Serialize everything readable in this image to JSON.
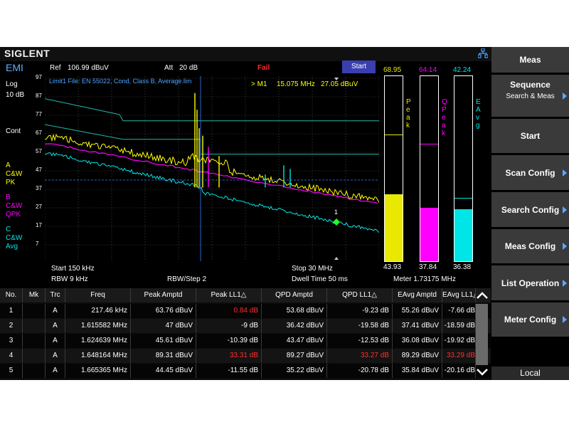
{
  "brand": "SIGLENT",
  "mode": "EMI",
  "scale": {
    "type": "Log",
    "per_div": "10 dB"
  },
  "trigger": "Cont",
  "traces": [
    {
      "letter": "A",
      "l1": "C&W",
      "l2": "PK",
      "color": "#ffff00"
    },
    {
      "letter": "B",
      "l1": "C&W",
      "l2": "QPK",
      "color": "#ff00ff"
    },
    {
      "letter": "C",
      "l1": "C&W",
      "l2": "Avg",
      "color": "#00e5e5"
    }
  ],
  "ref": {
    "label": "Ref",
    "value": "106.99 dBuV"
  },
  "att": {
    "label": "Att",
    "value": "20 dB"
  },
  "status": "Fail",
  "start_button": "Start",
  "limit_file": "Limit1 File: EN 55022, Cond, Class B, Average.lim",
  "marker": {
    "label": "> M1",
    "freq": "15.075 MHz",
    "level": "27.05 dBuV",
    "number": "1"
  },
  "y_ticks": [
    "97",
    "87",
    "77",
    "67",
    "57",
    "47",
    "37",
    "27",
    "17",
    "7"
  ],
  "settings": {
    "start": "Start  150 kHz",
    "stop": "Stop  30 MHz",
    "rbw": "RBW  9 kHz",
    "rbw_step": "RBW/Step   2",
    "dwell": "Dwell Time   50 ms",
    "meter": "Meter  1.73175 MHz"
  },
  "meters": [
    {
      "name": "Peak",
      "top": "68.95",
      "bottom": "43.93",
      "fill": 0.36,
      "limit": 0.68,
      "color": "#e8e800"
    },
    {
      "name": "QPeak",
      "top": "64.14",
      "bottom": "37.84",
      "fill": 0.29,
      "limit": 0.63,
      "color": "#ff00ff"
    },
    {
      "name": "EAvg",
      "top": "42.24",
      "bottom": "36.38",
      "fill": 0.28,
      "limit": 0.34,
      "color": "#00e5e5"
    }
  ],
  "table": {
    "headers": [
      "No.",
      "Mk",
      "Trc",
      "Freq",
      "Peak Amptd",
      "Peak LL1△",
      "QPD Amptd",
      "QPD LL1△",
      "EAvg Amptd",
      "EAvg LL1△"
    ],
    "rows": [
      {
        "no": "1",
        "mk": "",
        "trc": "A",
        "freq": "217.46 kHz",
        "peak": "63.76 dBuV",
        "peak_ll": "0.84 dB",
        "peak_fail": true,
        "qpd": "53.68 dBuV",
        "qpd_ll": "-9.23 dB",
        "qpd_fail": false,
        "eavg": "55.26 dBuV",
        "eavg_ll": "-7.66 dB",
        "eavg_fail": false
      },
      {
        "no": "2",
        "mk": "",
        "trc": "A",
        "freq": "1.615582 MHz",
        "peak": "47 dBuV",
        "peak_ll": "-9 dB",
        "peak_fail": false,
        "qpd": "36.42 dBuV",
        "qpd_ll": "-19.58 dB",
        "qpd_fail": false,
        "eavg": "37.41 dBuV",
        "eavg_ll": "-18.59 dB",
        "eavg_fail": false
      },
      {
        "no": "3",
        "mk": "",
        "trc": "A",
        "freq": "1.624639 MHz",
        "peak": "45.61 dBuV",
        "peak_ll": "-10.39 dB",
        "peak_fail": false,
        "qpd": "43.47 dBuV",
        "qpd_ll": "-12.53 dB",
        "qpd_fail": false,
        "eavg": "36.08 dBuV",
        "eavg_ll": "-19.92 dB",
        "eavg_fail": false
      },
      {
        "no": "4",
        "mk": "",
        "trc": "A",
        "freq": "1.648164 MHz",
        "peak": "89.31 dBuV",
        "peak_ll": "33.31 dB",
        "peak_fail": true,
        "qpd": "89.27 dBuV",
        "qpd_ll": "33.27 dB",
        "qpd_fail": true,
        "eavg": "89.29 dBuV",
        "eavg_ll": "33.29 dB",
        "eavg_fail": true
      },
      {
        "no": "5",
        "mk": "",
        "trc": "A",
        "freq": "1.665365 MHz",
        "peak": "44.45 dBuV",
        "peak_ll": "-11.55 dB",
        "peak_fail": false,
        "qpd": "35.22 dBuV",
        "qpd_ll": "-20.78 dB",
        "qpd_fail": false,
        "eavg": "35.84 dBuV",
        "eavg_ll": "-20.16 dB",
        "eavg_fail": false
      }
    ]
  },
  "menu": [
    {
      "label": "Meas",
      "sub": "",
      "arrow": false
    },
    {
      "label": "Sequence",
      "sub": "Search & Meas",
      "arrow": true
    },
    {
      "label": "Start",
      "sub": "",
      "arrow": false
    },
    {
      "label": "Scan Config",
      "sub": "",
      "arrow": true
    },
    {
      "label": "Search Config",
      "sub": "",
      "arrow": true
    },
    {
      "label": "Meas Config",
      "sub": "",
      "arrow": true
    },
    {
      "label": "List Operation",
      "sub": "",
      "arrow": true
    },
    {
      "label": "Meter Config",
      "sub": "",
      "arrow": true
    }
  ],
  "local": "Local"
}
